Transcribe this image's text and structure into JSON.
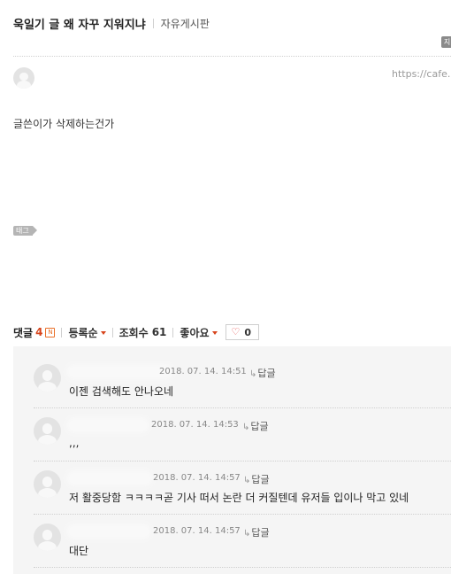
{
  "post": {
    "title": "욱일기 글 왜 자꾸 지워지냐",
    "board": "자유게시판",
    "url": "https://cafe.n",
    "body": "글쓴이가 삭제하는건가",
    "tag_label": "태그",
    "corner_icon_label": "지"
  },
  "stats": {
    "comment_label": "댓글",
    "comment_count": "4",
    "new_badge": "N",
    "sort_label": "등록순",
    "views_label": "조회수",
    "views_value": "61",
    "like_menu_label": "좋아요",
    "like_count": "0"
  },
  "comments": [
    {
      "date": "2018. 07. 14.  14:51",
      "reply_label": "답글",
      "text": "이젠 검색해도 안나오네"
    },
    {
      "date": "2018. 07. 14.  14:53",
      "reply_label": "답글",
      "text": ",,,"
    },
    {
      "date": "2018. 07. 14.  14:57",
      "reply_label": "답글",
      "text": "저 활중당함 ㅋㅋㅋㅋ곧 기사 떠서 논란 더 커질텐데 유저들 입이나 막고 있네"
    },
    {
      "date": "2018. 07. 14.  14:57",
      "reply_label": "답글",
      "text": "대단"
    }
  ]
}
